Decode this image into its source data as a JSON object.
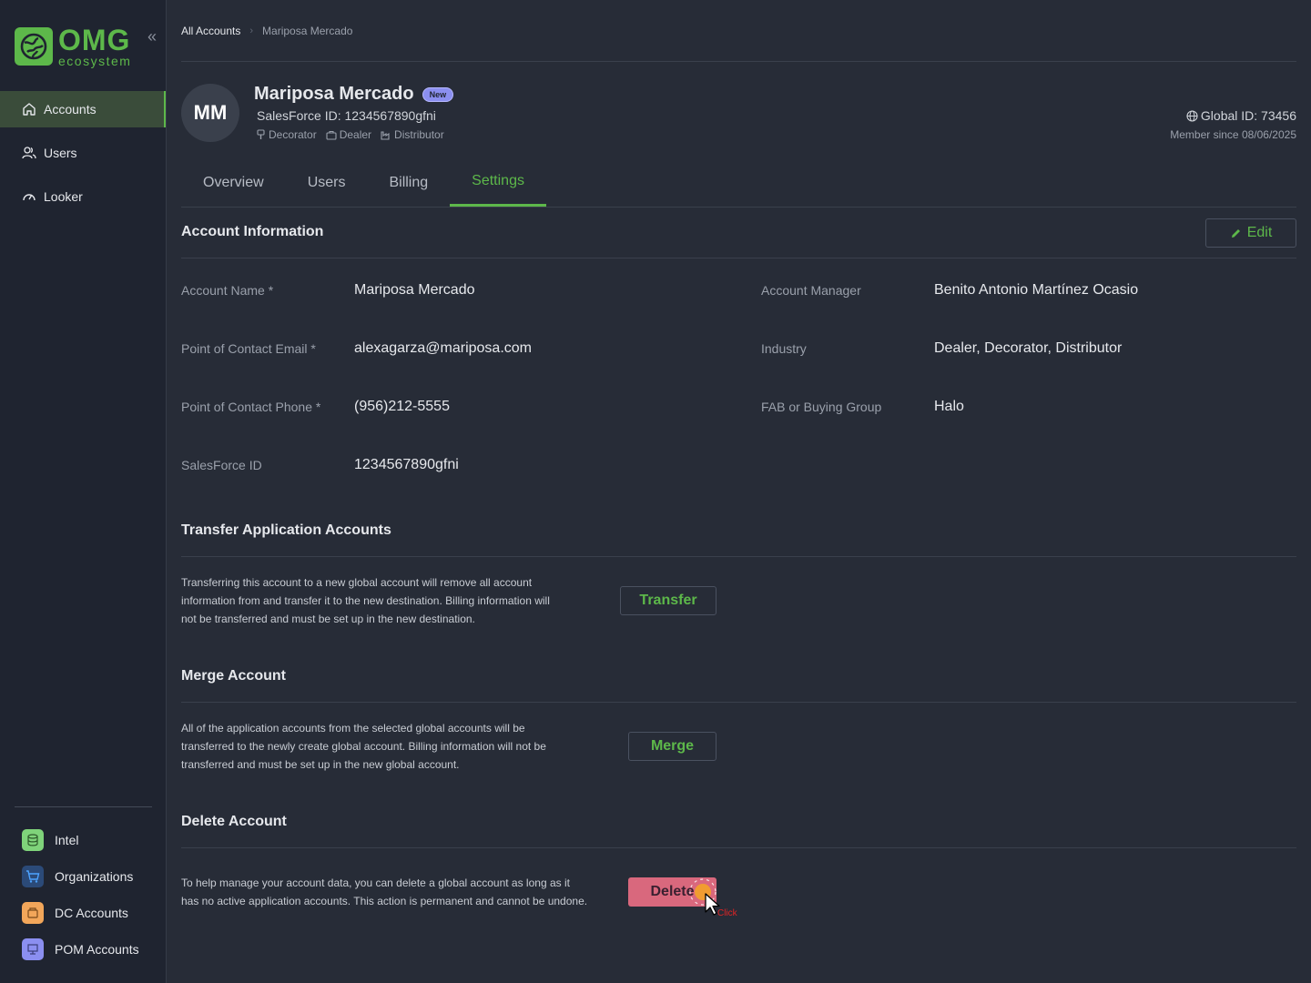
{
  "brand": {
    "name": "OMG",
    "subtitle": "ecosystem",
    "color": "#5db84a"
  },
  "sidebar": {
    "collapse_icon": "double-chevron-left-icon",
    "items": [
      {
        "label": "Accounts",
        "icon": "home-icon",
        "active": true
      },
      {
        "label": "Users",
        "icon": "users-icon",
        "active": false
      },
      {
        "label": "Looker",
        "icon": "gauge-icon",
        "active": false
      }
    ],
    "apps": [
      {
        "label": "Intel",
        "icon": "database-icon",
        "color": "#7fd37a"
      },
      {
        "label": "Organizations",
        "icon": "cart-icon",
        "color": "#4da3ff"
      },
      {
        "label": "DC Accounts",
        "icon": "box-icon",
        "color": "#f2a65a"
      },
      {
        "label": "POM Accounts",
        "icon": "easel-icon",
        "color": "#8b8ff0"
      }
    ]
  },
  "breadcrumb": {
    "root": "All Accounts",
    "current": "Mariposa Mercado"
  },
  "account": {
    "initials": "MM",
    "name": "Mariposa Mercado",
    "badge": "New",
    "salesforce_line": "SalesForce ID: 1234567890gfni",
    "tags": [
      "Decorator",
      "Dealer",
      "Distributor"
    ],
    "global_id": "Global ID: 73456",
    "member_since": "Member since 08/06/2025"
  },
  "tabs": [
    {
      "label": "Overview",
      "active": false
    },
    {
      "label": "Users",
      "active": false
    },
    {
      "label": "Billing",
      "active": false
    },
    {
      "label": "Settings",
      "active": true
    }
  ],
  "account_info": {
    "title": "Account Information",
    "edit_label": "Edit",
    "left_fields": [
      {
        "label": "Account Name *",
        "value": "Mariposa Mercado"
      },
      {
        "label": "Point of Contact Email *",
        "value": "alexagarza@mariposa.com"
      },
      {
        "label": "Point of Contact Phone *",
        "value": "(956)212-5555"
      },
      {
        "label": "SalesForce ID",
        "value": "1234567890gfni"
      }
    ],
    "right_fields": [
      {
        "label": "Account Manager",
        "value": "Benito Antonio Martínez Ocasio"
      },
      {
        "label": "Industry",
        "value": "Dealer, Decorator, Distributor"
      },
      {
        "label": "FAB or Buying Group",
        "value": "Halo"
      }
    ]
  },
  "transfer": {
    "title": "Transfer Application Accounts",
    "lines": [
      "Transferring this account to a new global account will remove all account",
      "information from and transfer it to the new destination. Billing information will",
      "not be transferred and must be set up in the new destination."
    ],
    "button": "Transfer"
  },
  "merge": {
    "title": "Merge Account",
    "lines": [
      "All of the application accounts from the selected global accounts will be",
      "transferred to the newly create global account. Billing information will not be",
      "transferred and must be set up in the new global account."
    ],
    "button": "Merge"
  },
  "delete": {
    "title": "Delete Account",
    "lines": [
      "To help manage your account data, you can delete a global account as long as it",
      "has no active application accounts. This action is permanent and cannot be undone."
    ],
    "button": "Delete",
    "click_label": "Click",
    "danger_color": "#d9687d"
  }
}
